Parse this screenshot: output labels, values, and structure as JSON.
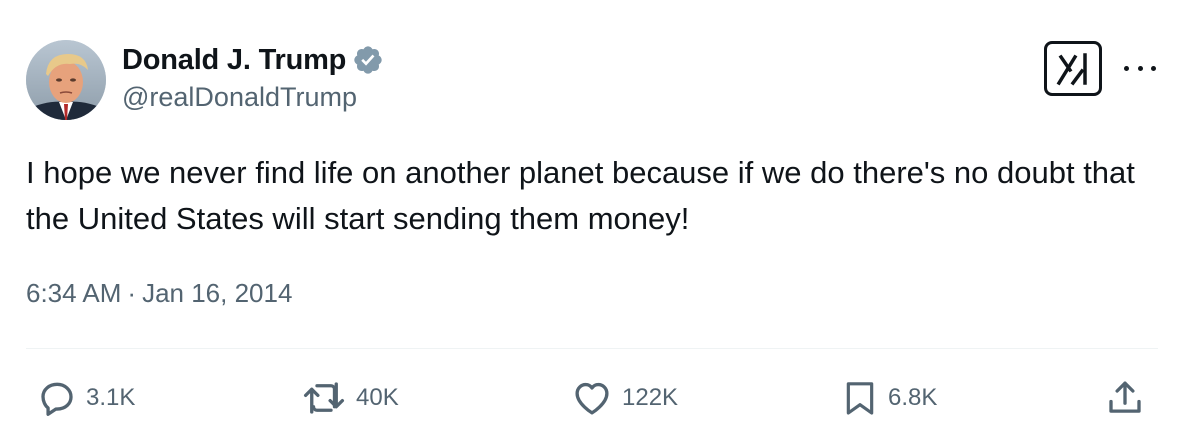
{
  "author": {
    "name": "Donald J. Trump",
    "handle": "@realDonaldTrump",
    "verified": true
  },
  "post": {
    "text": "I hope we never find life on another planet because if we do there's no doubt that the United States will start sending them money!",
    "time": "6:34 AM",
    "separator": "·",
    "date": "Jan 16, 2014"
  },
  "stats": {
    "replies": "3.1K",
    "reposts": "40K",
    "likes": "122K",
    "bookmarks": "6.8K"
  },
  "icons": {
    "verified": "verified-badge-icon",
    "grok": "grok-icon",
    "more": "more-icon",
    "reply": "reply-icon",
    "repost": "repost-icon",
    "like": "heart-icon",
    "bookmark": "bookmark-icon",
    "share": "share-icon"
  },
  "colors": {
    "text": "#0f1419",
    "secondary": "#536471",
    "verified": "#829aab",
    "divider": "#eff3f4"
  }
}
